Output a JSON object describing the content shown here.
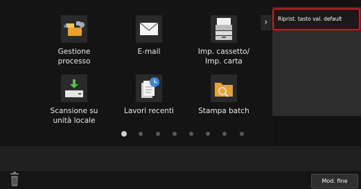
{
  "side_panel": {
    "reset_label": "Riprist. tasto val. default",
    "toggle_icon": "chevron-right"
  },
  "tiles": [
    {
      "label": "Gestione\nprocesso",
      "icon": "job-management-icon"
    },
    {
      "label": "E-mail",
      "icon": "envelope-icon"
    },
    {
      "label": "Imp. cassetto/\nImp. carta",
      "icon": "paper-tray-icon"
    },
    {
      "label": "Scansione su\nunità locale",
      "icon": "scan-to-local-icon"
    },
    {
      "label": "Lavori recenti",
      "icon": "recent-jobs-icon"
    },
    {
      "label": "Stampa batch",
      "icon": "batch-print-icon"
    }
  ],
  "pager": {
    "pages": 8,
    "active_page": 1
  },
  "footer": {
    "end_label": "Mod. fine"
  },
  "colors": {
    "highlight_border": "#d5141b",
    "folder_orange": "#e8a22a",
    "accent_blue": "#3b86d9"
  }
}
